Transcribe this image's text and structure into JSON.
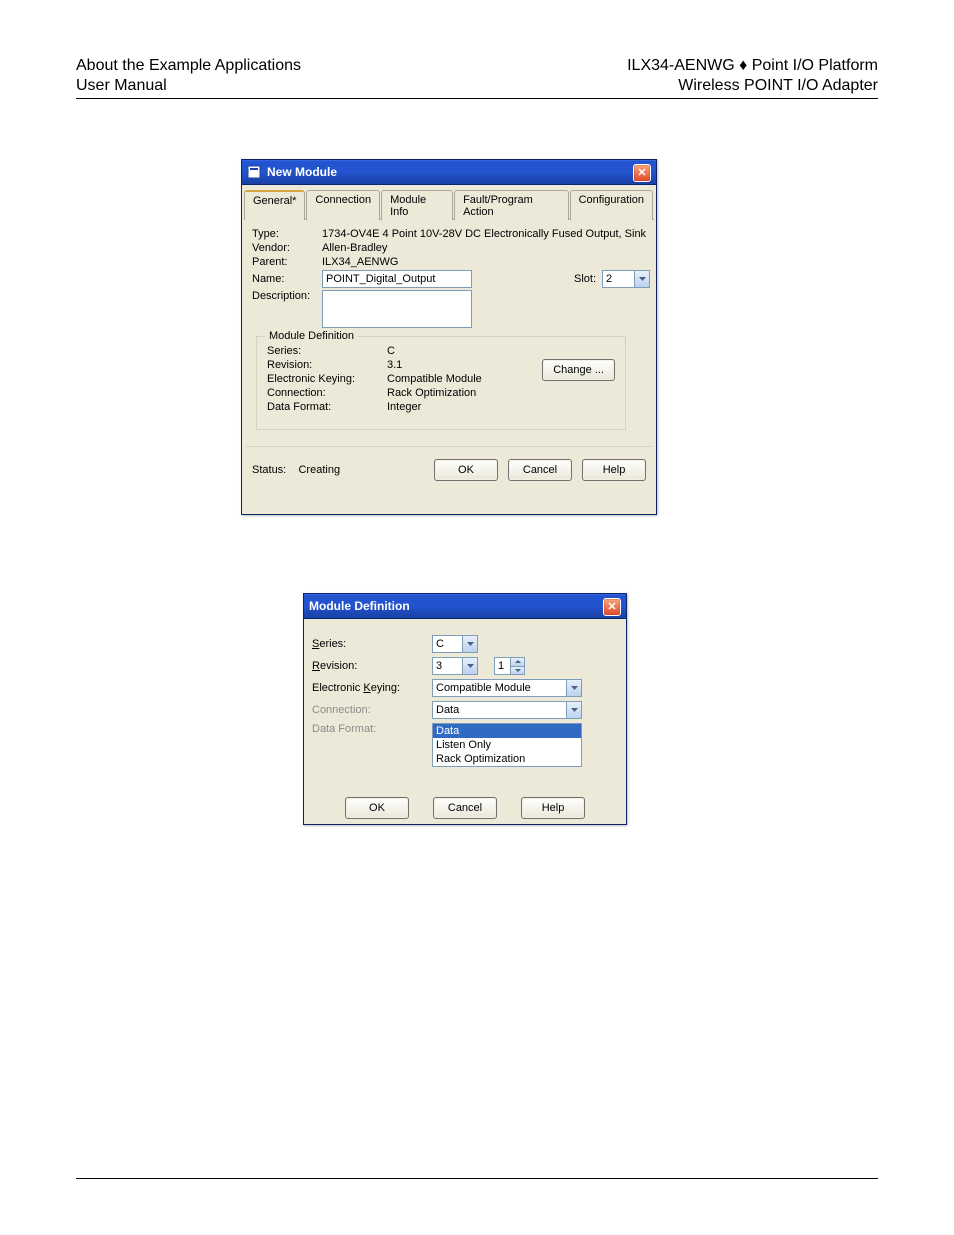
{
  "header": {
    "left_line1": "About the Example Applications",
    "left_line2": "User Manual",
    "right_line1": "ILX34-AENWG ♦ Point I/O Platform",
    "right_line2": "Wireless POINT I/O Adapter"
  },
  "dialog1": {
    "title": "New Module",
    "tabs": {
      "general": "General*",
      "connection": "Connection",
      "module_info": "Module Info",
      "fault_action": "Fault/Program Action",
      "configuration": "Configuration"
    },
    "labels": {
      "type": "Type:",
      "vendor": "Vendor:",
      "parent": "Parent:",
      "name": "Name:",
      "description": "Description:",
      "slot": "Slot:",
      "status": "Status:"
    },
    "values": {
      "type": "1734-OV4E 4 Point 10V-28V DC Electronically Fused Output, Sink",
      "vendor": "Allen-Bradley",
      "parent": "ILX34_AENWG",
      "name": "POINT_Digital_Output",
      "description": "",
      "slot": "2",
      "status": "Creating"
    },
    "module_def": {
      "legend": "Module Definition",
      "labels": {
        "series": "Series:",
        "revision": "Revision:",
        "keying": "Electronic Keying:",
        "connection": "Connection:",
        "data_format": "Data Format:"
      },
      "values": {
        "series": "C",
        "revision": "3.1",
        "keying": "Compatible Module",
        "connection": "Rack Optimization",
        "data_format": "Integer"
      },
      "change_btn": "Change ..."
    },
    "buttons": {
      "ok": "OK",
      "cancel": "Cancel",
      "help": "Help"
    }
  },
  "dialog2": {
    "title": "Module Definition",
    "labels": {
      "series": "Series:",
      "revision": "Revision:",
      "keying": "Electronic Keying:",
      "connection": "Connection:",
      "data_format": "Data Format:"
    },
    "values": {
      "series": "C",
      "revision_major": "3",
      "revision_minor": "1",
      "keying": "Compatible Module",
      "connection": "Data"
    },
    "data_format_options": {
      "data": "Data",
      "listen_only": "Listen Only",
      "rack_opt": "Rack Optimization"
    },
    "buttons": {
      "ok": "OK",
      "cancel": "Cancel",
      "help": "Help"
    }
  }
}
